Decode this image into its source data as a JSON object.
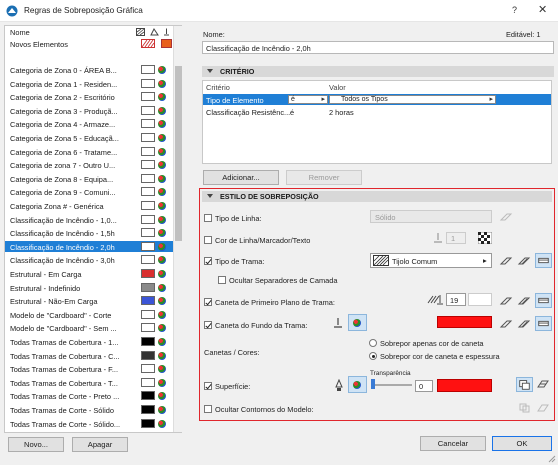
{
  "window": {
    "title": "Regras de Sobreposição Gráfica",
    "help_label": "?",
    "close_label": "✕"
  },
  "list": {
    "header_name": "Nome",
    "new_elements": "Novos Elementos",
    "items": [
      {
        "label": "Categoria de Zona 0 - ÁREA B...",
        "swatch": "#ffffff",
        "globe": true
      },
      {
        "label": "Categoria de Zona 1 - Residen...",
        "swatch": "#ffffff",
        "globe": true
      },
      {
        "label": "Categoria de Zona 2 - Escritório",
        "swatch": "#ffffff",
        "globe": true
      },
      {
        "label": "Categoria de Zona 3 - Produçã...",
        "swatch": "#ffffff",
        "globe": true
      },
      {
        "label": "Categoria de Zona 4 - Armaze...",
        "swatch": "#ffffff",
        "globe": true
      },
      {
        "label": "Categoria de Zona 5 - Educaçã...",
        "swatch": "#ffffff",
        "globe": true
      },
      {
        "label": "Categoria de Zona 6 - Tratame...",
        "swatch": "#ffffff",
        "globe": true
      },
      {
        "label": "Categoria de zona 7 - Outro U...",
        "swatch": "#ffffff",
        "globe": true
      },
      {
        "label": "Categoria de Zona 8 - Equipa...",
        "swatch": "#ffffff",
        "globe": true
      },
      {
        "label": "Categoria de Zona 9 - Comuni...",
        "swatch": "#ffffff",
        "globe": true
      },
      {
        "label": "Categoria Zona # - Genérica",
        "swatch": "#ffffff",
        "globe": true
      },
      {
        "label": "Classificação de Incêndio - 1,0...",
        "swatch": "#ffffff",
        "globe": true
      },
      {
        "label": "Classificação de Incêndio - 1,5h",
        "swatch": "#ffffff",
        "globe": true
      },
      {
        "label": "Classificação de Incêndio - 2,0h",
        "swatch": "#ffffff",
        "globe": true,
        "selected": true
      },
      {
        "label": "Classificação de Incêndio - 3,0h",
        "swatch": "#ffffff",
        "globe": true
      },
      {
        "label": "Estrutural - Em Carga",
        "swatch": "#d93030",
        "globe": true
      },
      {
        "label": "Estrutural - Indefinido",
        "swatch": "#8a8a8a",
        "globe": true
      },
      {
        "label": "Estrutural - Não-Em Carga",
        "swatch": "#3b55d6",
        "globe": true
      },
      {
        "label": "Modelo de \"Cardboard\" - Corte",
        "swatch": "#ffffff",
        "globe": true
      },
      {
        "label": "Modelo de \"Cardboard\" - Sem ...",
        "swatch": "#ffffff",
        "globe": true
      },
      {
        "label": "Todas Tramas de Cobertura - 1...",
        "swatch": "#000000",
        "globe": true
      },
      {
        "label": "Todas Tramas de Cobertura - C...",
        "swatch": "#333333",
        "globe": true
      },
      {
        "label": "Todas Tramas de Cobertura - F...",
        "swatch": "#ffffff",
        "globe": true
      },
      {
        "label": "Todas Tramas de Cobertura - T...",
        "swatch": "#ffffff",
        "globe": true
      },
      {
        "label": "Todas Tramas de Corte - Preto ...",
        "swatch": "#000000",
        "globe": true
      },
      {
        "label": "Todas Tramas de Corte - Sólido",
        "swatch": "#000000",
        "globe": true
      },
      {
        "label": "Todas Tramas de Corte - Sólido...",
        "swatch": "#000000",
        "globe": true
      }
    ]
  },
  "buttons": {
    "new": "Novo...",
    "delete": "Apagar",
    "add": "Adicionar...",
    "remove": "Remover",
    "cancel": "Cancelar",
    "ok": "OK"
  },
  "name_section": {
    "label": "Nome:",
    "value": "Classificação de Incêndio - 2,0h",
    "editable": "Editável: 1"
  },
  "criteria": {
    "section_title": "CRITÉRIO",
    "col_criterion": "Critério",
    "col_value": "Valor",
    "rows": [
      {
        "criterion": "Tipo de Elemento",
        "operator": "é",
        "value": "Todos os Tipos",
        "selected": true
      },
      {
        "criterion": "Classificação Resistênc...",
        "operator": "é",
        "value": "2 horas",
        "selected": false
      }
    ]
  },
  "style": {
    "section_title": "ESTILO DE SOBREPOSIÇÃO",
    "line_type": {
      "label": "Tipo de Linha:",
      "value": "Sólido",
      "checked": false
    },
    "line_color": {
      "label": "Cor de Linha/Marcador/Texto",
      "pen": "1",
      "checked": false
    },
    "fill_type": {
      "label": "Tipo de Trama:",
      "value": "Tijolo Comum",
      "checked": true
    },
    "hide_separators": {
      "label": "Ocultar Separadores de Camada",
      "checked": false
    },
    "fg_pen": {
      "label": "Caneta de Primeiro Plano de Trama:",
      "pen": "19",
      "checked": true
    },
    "bg_pen": {
      "label": "Caneta do Fundo da Trama:",
      "checked": true,
      "color": "#ff1111"
    },
    "pens_colors_label": "Canetas / Cores:",
    "radio1": "Sobrepor apenas cor de caneta",
    "radio2": "Sobrepor cor de caneta e espessura",
    "surface": {
      "label": "Superfície:",
      "transparency_label": "Transparência",
      "transparency_value": "0",
      "checked": true,
      "color": "#ff1111"
    },
    "hide_contours": {
      "label": "Ocultar Contornos do Modelo:",
      "checked": false
    }
  },
  "colors": {
    "new_elements_swatch1": "#ffffff",
    "new_elements_swatch2": "#e8601c",
    "accent": "#1f7fd6",
    "highlight_border": "#e0262c"
  }
}
